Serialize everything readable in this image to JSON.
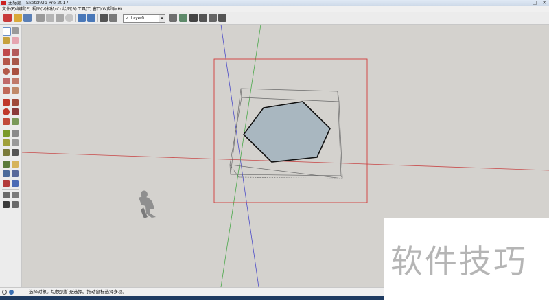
{
  "window": {
    "title": "无标题 - SketchUp Pro 2017",
    "controls": {
      "minimize": "–",
      "maximize": "□",
      "close": "✕"
    }
  },
  "menu": {
    "items": [
      "文件(F)",
      "编辑(E)",
      "视图(V)",
      "相机(C)",
      "绘图(R)",
      "工具(T)",
      "窗口(W)",
      "帮助(H)"
    ]
  },
  "toolbar": {
    "icons": [
      "sketchup-logo-icon",
      "open-icon",
      "save-icon",
      "cut-icon",
      "copy-icon",
      "paste-icon",
      "erase-icon",
      "undo-icon",
      "redo-icon",
      "print-icon",
      "model-info-icon"
    ],
    "layer": {
      "check": "✓",
      "name": "Layer0",
      "arrow": "▾"
    },
    "view_icons": [
      "iso-view-icon",
      "top-view-icon",
      "front-view-icon",
      "right-view-icon",
      "back-view-icon",
      "left-view-icon"
    ]
  },
  "left_toolbar": {
    "icons": [
      "select-icon",
      "make-component-icon",
      "paint-bucket-icon",
      "eraser-icon",
      "line-icon",
      "freehand-icon",
      "rectangle-icon",
      "rotated-rectangle-icon",
      "circle-icon",
      "polygon-icon",
      "arc-icon",
      "pie-icon",
      "move-icon",
      "push-pull-icon",
      "rotate-icon",
      "follow-me-icon",
      "scale-icon",
      "offset-icon",
      "tape-measure-icon",
      "dimension-icon",
      "protractor-icon",
      "text-icon",
      "axes-icon",
      "3d-text-icon",
      "orbit-icon",
      "pan-icon",
      "zoom-icon",
      "zoom-window-icon",
      "zoom-extents-icon",
      "previous-view-icon",
      "position-camera-icon",
      "look-around-icon",
      "walk-icon",
      "section-plane-icon"
    ]
  },
  "status": {
    "text": "选择对象。切换到扩充选择。拖动鼠标选择多项。"
  },
  "watermark": {
    "text": "软件技巧"
  },
  "colors": {
    "viewport_bg": "#d4d2ce",
    "axis_red": "#c84a4a",
    "axis_green": "#4aa84a",
    "axis_blue": "#4a4ac8",
    "face_fill": "#a9b7c0",
    "selection_box": "#d23a3a"
  }
}
